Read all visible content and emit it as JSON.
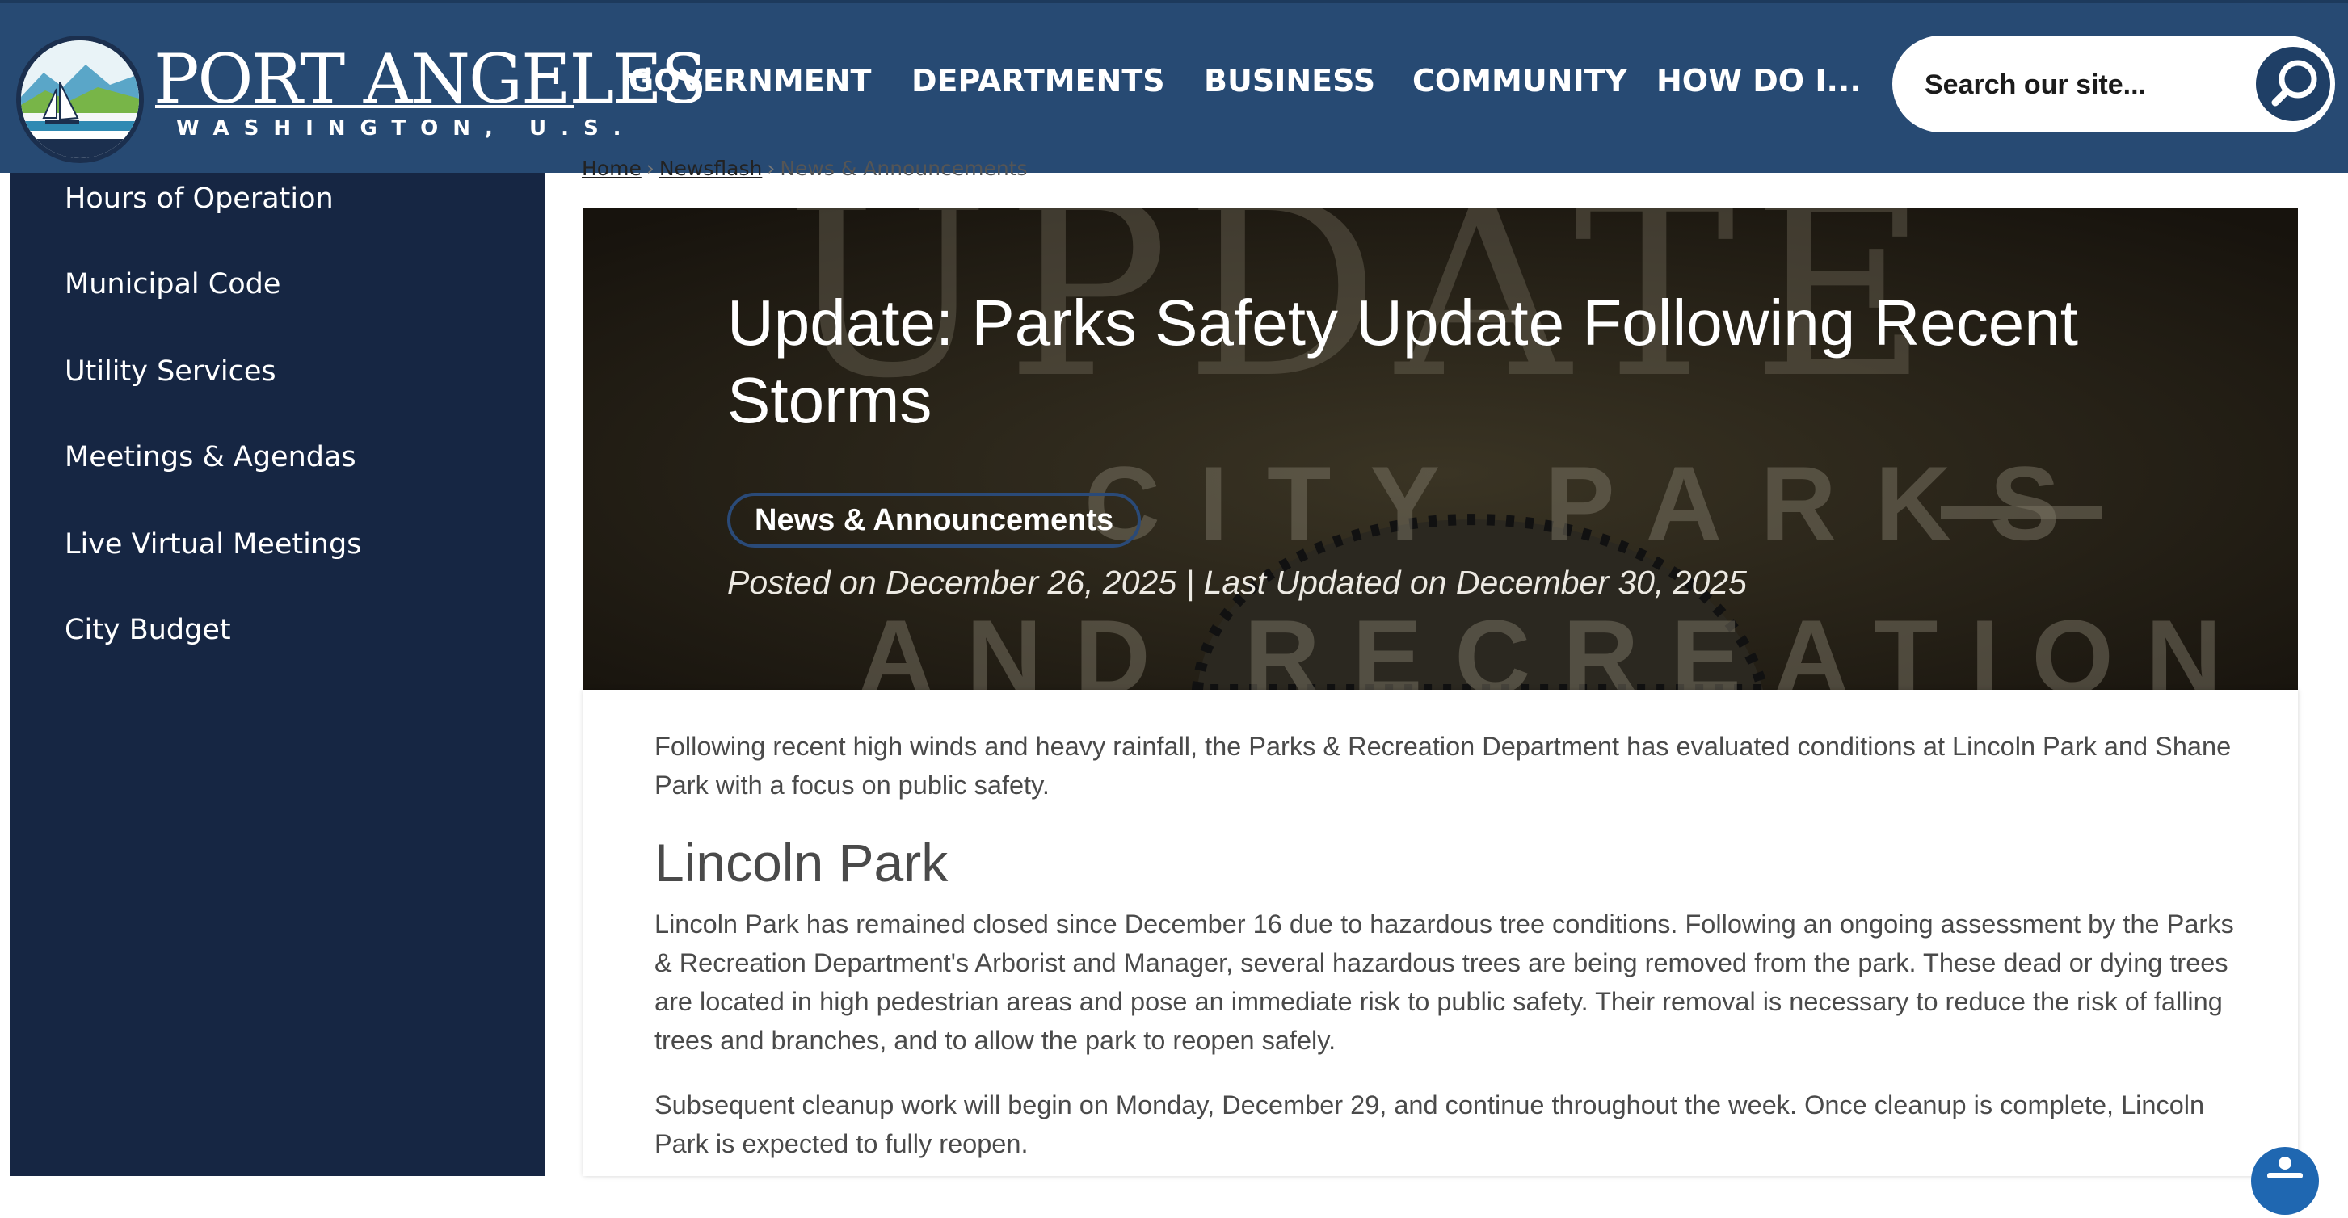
{
  "header": {
    "logo_title": "PORT ANGELES",
    "logo_subtitle": "WASHINGTON, U.S.",
    "nav": [
      "GOVERNMENT",
      "DEPARTMENTS",
      "BUSINESS",
      "COMMUNITY",
      "HOW DO I..."
    ],
    "search_placeholder": "Search our site..."
  },
  "sidebar": {
    "items": [
      "Hours of Operation",
      "Municipal Code",
      "Utility Services",
      "Meetings & Agendas",
      "Live Virtual Meetings",
      "City Budget"
    ]
  },
  "breadcrumb": {
    "items": [
      "Home",
      "Newsflash",
      "News & Announcements"
    ]
  },
  "hero": {
    "bg_text_top": "UPDATE",
    "bg_text_mid": "CITY PARKS",
    "bg_text_bottom": "AND RECREATION",
    "title": "Update: Parks Safety Update Following Recent Storms",
    "tag": "News & Announcements",
    "date_line": "Posted on December 26, 2025 | Last Updated on December 30, 2025"
  },
  "article": {
    "intro": "Following recent high winds and heavy rainfall, the Parks & Recreation Department has evaluated conditions at Lincoln Park and Shane Park with a focus on public safety.",
    "heading": "Lincoln Park",
    "para1": "Lincoln Park has remained closed since December 16 due to hazardous tree conditions. Following an ongoing assessment by the Parks & Recreation Department's Arborist and Manager, several hazardous trees are being removed from the park. These dead or dying trees are located in high pedestrian areas and pose an immediate risk to public safety. Their removal is necessary to reduce the risk of falling trees and branches, and to allow the park to reopen safely.",
    "para2": "Subsequent cleanup work will begin on Monday, December 29, and continue throughout the week. Once cleanup is complete, Lincoln Park is expected to fully reopen."
  },
  "colors": {
    "header_bg": "#274a73",
    "sidebar_bg": "#162643",
    "hero_bg": "#1f1a12",
    "accent": "#1f3f66",
    "tag_border": "#2a4a78",
    "body_text": "#4a4a4a"
  },
  "icons": {
    "search": "search-icon",
    "accessibility": "accessibility-icon",
    "logo": "city-seal-logo"
  }
}
